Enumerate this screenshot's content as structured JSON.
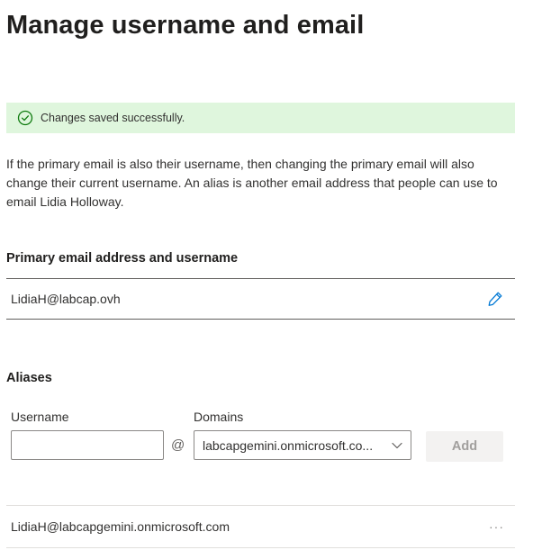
{
  "page": {
    "title": "Manage username and email"
  },
  "banner": {
    "message": "Changes saved successfully.",
    "icon": "checkmark-circle-icon",
    "color": "#dff6dd"
  },
  "description": "If the primary email is also their username, then changing the primary email will also change their current username. An alias is another email address that people can use to email Lidia Holloway.",
  "primary": {
    "label": "Primary email address and username",
    "value": "LidiaH@labcap.ovh",
    "edit_icon": "pencil-icon"
  },
  "aliases": {
    "label": "Aliases",
    "username_label": "Username",
    "username_value": "",
    "at_symbol": "@",
    "domains_label": "Domains",
    "domain_selected": "labcapgemini.onmicrosoft.co...",
    "add_label": "Add",
    "list": [
      {
        "address": "LidiaH@labcapgemini.onmicrosoft.com",
        "more_label": "···"
      }
    ]
  },
  "colors": {
    "accent": "#0078d4",
    "success_icon": "#107c10"
  }
}
